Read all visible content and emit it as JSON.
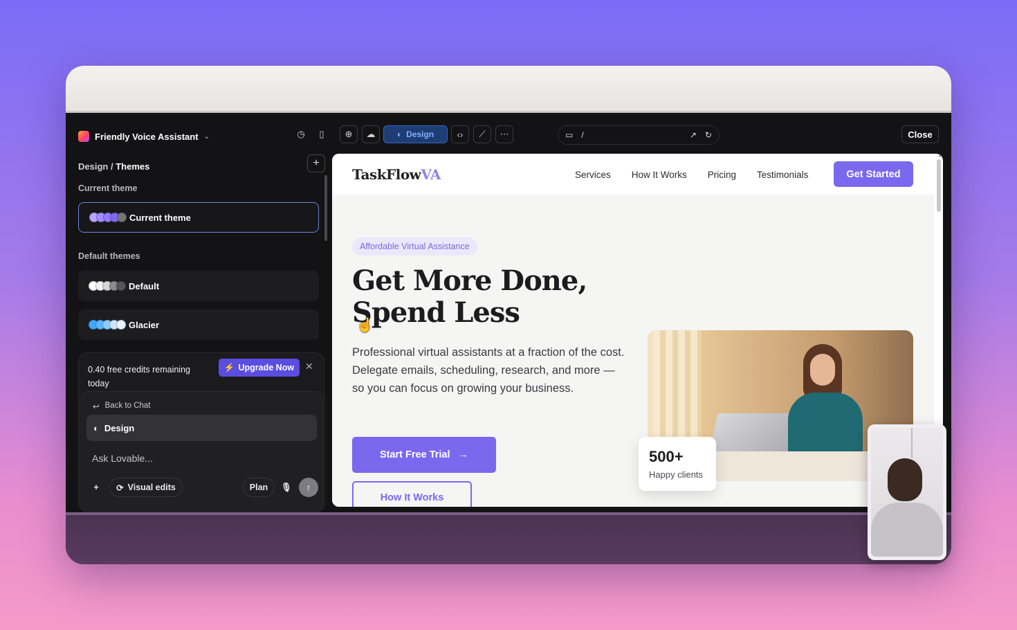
{
  "topbar": {
    "project_name": "Friendly Voice Assistant",
    "design_label": "Design",
    "url_path": "/",
    "close_label": "Close"
  },
  "left": {
    "breadcrumb_section": "Design",
    "breadcrumb_sep": "/",
    "breadcrumb_page": "Themes",
    "current_theme_heading": "Current theme",
    "current_theme": {
      "label": "Current theme",
      "dots": [
        "#b9a6ff",
        "#a48bff",
        "#9579ff",
        "#8268ef",
        "#767679"
      ]
    },
    "default_themes_heading": "Default themes",
    "themes": [
      {
        "label": "Default",
        "dots": [
          "#ffffff",
          "#f2f2f2",
          "#d6d6d8",
          "#8a8a8f",
          "#55555a"
        ]
      },
      {
        "label": "Glacier",
        "dots": [
          "#40a9ff",
          "#5cb8ff",
          "#8ccbff",
          "#c8e5ff",
          "#e8f4ff"
        ]
      }
    ],
    "credits_text": "0.40 free credits remaining today",
    "upgrade_label": "Upgrade Now",
    "back_label": "Back to Chat",
    "design_row_label": "Design",
    "ask_placeholder": "Ask Lovable...",
    "visual_edits_label": "Visual edits",
    "plan_label": "Plan"
  },
  "preview": {
    "brand_main": "TaskFlow",
    "brand_accent": "VA",
    "nav_links": [
      "Services",
      "How It Works",
      "Pricing",
      "Testimonials"
    ],
    "get_started": "Get Started",
    "badge": "Affordable Virtual Assistance",
    "headline": "Get More Done, Spend Less",
    "lead": "Professional virtual assistants at a fraction of the cost. Delegate emails, scheduling, research, and more — so you can focus on growing your business.",
    "cta_primary": "Start Free Trial",
    "cta_secondary": "How It Works",
    "stat_number": "500+",
    "stat_label": "Happy clients"
  },
  "colors": {
    "accent": "#7b68ee",
    "design_pill": "#1f3d75"
  }
}
